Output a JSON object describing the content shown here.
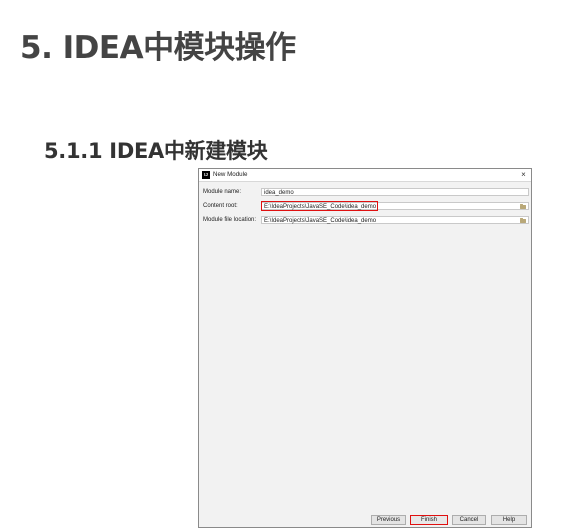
{
  "doc": {
    "heading_main": "5. IDEA中模块操作",
    "heading_sub": "5.1.1 IDEA中新建模块"
  },
  "dialog": {
    "app_icon_text": "IJ",
    "title": "New Module",
    "close_glyph": "×",
    "fields": {
      "module_name": {
        "label": "Module name:",
        "value": "idea_demo"
      },
      "content_root": {
        "label": "Content root:",
        "value": "E:\\IdeaProjects\\JavaSE_Code\\idea_demo"
      },
      "module_file_location": {
        "label": "Module file location:",
        "value": "E:\\IdeaProjects\\JavaSE_Code\\idea_demo"
      }
    },
    "buttons": {
      "previous": "Previous",
      "finish": "Finish",
      "cancel": "Cancel",
      "help": "Help"
    }
  },
  "colors": {
    "highlight": "#e01010",
    "dialog_bg": "#f2f2f2"
  }
}
